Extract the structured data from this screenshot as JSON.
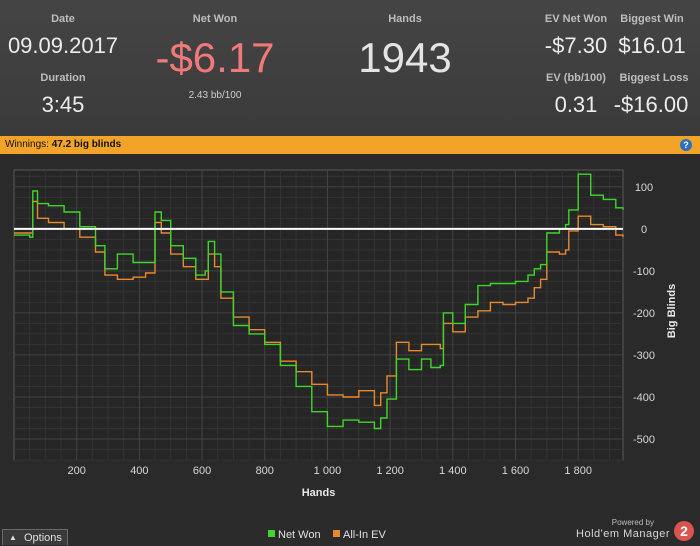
{
  "stats": {
    "date": {
      "label": "Date",
      "value": "09.09.2017"
    },
    "duration": {
      "label": "Duration",
      "value": "3:45"
    },
    "net_won": {
      "label": "Net Won",
      "value": "-$6.17",
      "sub": "2.43 bb/100",
      "color": "#f07a7a"
    },
    "hands": {
      "label": "Hands",
      "value": "1943"
    },
    "ev_net_won": {
      "label": "EV Net Won",
      "value": "-$7.30"
    },
    "biggest_win": {
      "label": "Biggest Win",
      "value": "$16.01"
    },
    "ev_bb100": {
      "label": "EV (bb/100)",
      "value": "0.31"
    },
    "biggest_loss": {
      "label": "Biggest Loss",
      "value": "-$16.00"
    }
  },
  "winnings_bar": {
    "prefix": "Winnings:",
    "value": "47.2 big blinds",
    "color": "#f2a42a"
  },
  "help_icon": "help-icon",
  "chart_data": {
    "type": "line",
    "xlabel": "Hands",
    "ylabel": "Big Blinds",
    "xlim": [
      0,
      1943
    ],
    "ylim": [
      -550,
      140
    ],
    "x_ticks": [
      200,
      400,
      600,
      800,
      1000,
      1200,
      1400,
      1600,
      1800
    ],
    "x_tick_labels": [
      "200",
      "400",
      "600",
      "800",
      "1 000",
      "1 200",
      "1 400",
      "1 600",
      "1 800"
    ],
    "y_ticks": [
      100,
      0,
      -100,
      -200,
      -300,
      -400,
      -500
    ],
    "y_tick_labels": [
      "100",
      "0",
      "-100",
      "-200",
      "-300",
      "-400",
      "-500"
    ],
    "grid": true,
    "legend": "bottom",
    "x": [
      0,
      50,
      60,
      75,
      110,
      160,
      210,
      260,
      290,
      330,
      380,
      420,
      450,
      470,
      500,
      540,
      580,
      610,
      620,
      640,
      660,
      700,
      750,
      800,
      850,
      900,
      950,
      1000,
      1050,
      1100,
      1150,
      1170,
      1190,
      1220,
      1260,
      1300,
      1330,
      1360,
      1370,
      1400,
      1440,
      1480,
      1520,
      1560,
      1600,
      1640,
      1660,
      1680,
      1700,
      1740,
      1760,
      1770,
      1800,
      1840,
      1880,
      1920,
      1943
    ],
    "series": [
      {
        "name": "Net Won",
        "color": "#3fd62c",
        "values": [
          -15,
          -20,
          90,
          60,
          55,
          40,
          5,
          -40,
          -95,
          -60,
          -80,
          -80,
          40,
          20,
          -40,
          -70,
          -110,
          -100,
          -30,
          -60,
          -150,
          -230,
          -250,
          -275,
          -325,
          -375,
          -435,
          -470,
          -455,
          -460,
          -475,
          -450,
          -405,
          -310,
          -335,
          -310,
          -330,
          -325,
          -200,
          -225,
          -180,
          -135,
          -130,
          -130,
          -125,
          -110,
          -95,
          -85,
          -10,
          0,
          10,
          45,
          130,
          80,
          70,
          50,
          45
        ]
      },
      {
        "name": "All-In EV",
        "color": "#e8892e",
        "values": [
          -10,
          -10,
          65,
          25,
          15,
          0,
          -20,
          -55,
          -110,
          -120,
          -115,
          -105,
          15,
          -10,
          -60,
          -90,
          -120,
          -120,
          -60,
          -90,
          -165,
          -210,
          -240,
          -270,
          -315,
          -340,
          -370,
          -395,
          -400,
          -385,
          -420,
          -390,
          -350,
          -270,
          -290,
          -275,
          -275,
          -285,
          -225,
          -245,
          -210,
          -195,
          -175,
          -180,
          -175,
          -165,
          -140,
          -120,
          -55,
          -60,
          -50,
          -5,
          30,
          10,
          5,
          -15,
          -20
        ]
      }
    ]
  },
  "options_button": {
    "label": "Options"
  },
  "legend_labels": [
    "Net Won",
    "All-In EV"
  ],
  "brand": {
    "powered_by": "Powered by",
    "name": "Hold'em Manager",
    "logo_number": "2",
    "logo_color": "#d9534f"
  }
}
